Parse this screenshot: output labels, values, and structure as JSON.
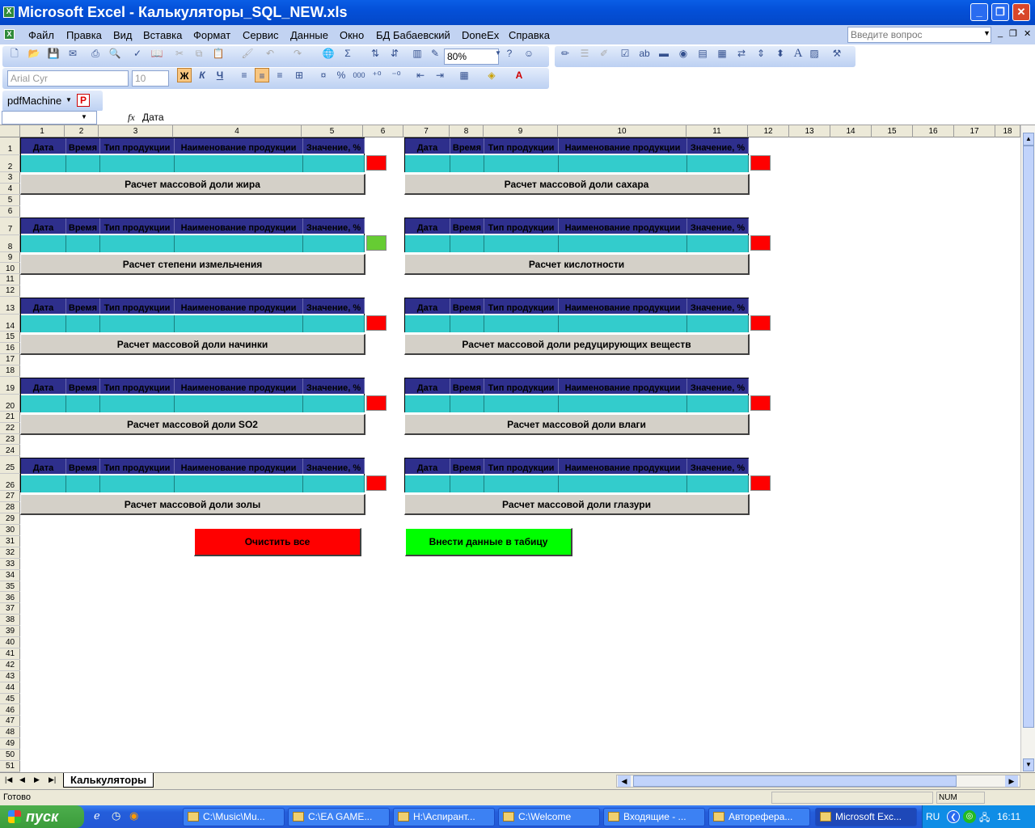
{
  "window": {
    "title": "Microsoft Excel - Калькуляторы_SQL_NEW.xls",
    "app_icon": "X"
  },
  "menu": [
    "Файл",
    "Правка",
    "Вид",
    "Вставка",
    "Формат",
    "Сервис",
    "Данные",
    "Окно",
    "БД Бабаевский",
    "DoneEx",
    "Справка"
  ],
  "help_box": {
    "placeholder": "Введите вопрос"
  },
  "toolbar": {
    "zoom": "80%",
    "font": "Arial Cyr",
    "size": "10",
    "bold": "Ж",
    "italic": "К",
    "underline": "Ч",
    "percent": "%",
    "thousands": "000"
  },
  "addin_toolbar": {
    "label": "pdfMachine"
  },
  "formula_bar": {
    "name_box": "",
    "fx": "fx",
    "content": "Дата"
  },
  "columns": [
    "1",
    "2",
    "3",
    "4",
    "5",
    "6",
    "7",
    "8",
    "9",
    "10",
    "11",
    "12",
    "13",
    "14",
    "15",
    "16",
    "17",
    "18"
  ],
  "rows": [
    "1",
    "2",
    "3",
    "4",
    "5",
    "6",
    "7",
    "8",
    "9",
    "10",
    "11",
    "12",
    "13",
    "14",
    "15",
    "16",
    "17",
    "18",
    "19",
    "20",
    "21",
    "22",
    "23",
    "24",
    "25",
    "26",
    "27",
    "28",
    "29",
    "30",
    "31",
    "32",
    "33",
    "34",
    "35",
    "36",
    "37",
    "38",
    "39",
    "40",
    "41",
    "42",
    "43",
    "44",
    "45",
    "46",
    "47",
    "48",
    "49",
    "50",
    "51"
  ],
  "table_headers": [
    "Дата",
    "Время",
    "Тип продукции",
    "Наименование продукции",
    "Значение, %"
  ],
  "calculators": {
    "left": [
      "Расчет массовой доли жира",
      "Расчет степени измельчения",
      "Расчет массовой доли начинки",
      "Расчет массовой доли SO2",
      "Расчет массовой доли золы"
    ],
    "right": [
      "Расчет массовой доли сахара",
      "Расчет кислотности",
      "Расчет массовой доли редуцирующих веществ",
      "Расчет массовой доли влаги",
      "Расчет массовой доли глазури"
    ]
  },
  "indicator_colors": {
    "left": [
      "#ff0000",
      "#66cc33",
      "#ff0000",
      "#ff0000",
      "#ff0000"
    ],
    "right": [
      "#ff0000",
      "#ff0000",
      "#ff0000",
      "#ff0000",
      "#ff0000"
    ]
  },
  "actions": {
    "clear": {
      "label": "Очистить все",
      "color": "#ff0000"
    },
    "submit": {
      "label": "Внести данные в табицу",
      "color": "#00ff00"
    }
  },
  "sheet_tab": "Калькуляторы",
  "status": {
    "ready": "Готово",
    "num": "NUM"
  },
  "taskbar": {
    "start": "пуск",
    "tasks": [
      "C:\\Music\\Mu...",
      "C:\\EA GAME...",
      "H:\\Аспирант...",
      "C:\\Welcome",
      "Входящие - ...",
      "Автореферa...",
      "Microsoft Exc..."
    ],
    "lang": "RU",
    "clock": "16:11"
  }
}
